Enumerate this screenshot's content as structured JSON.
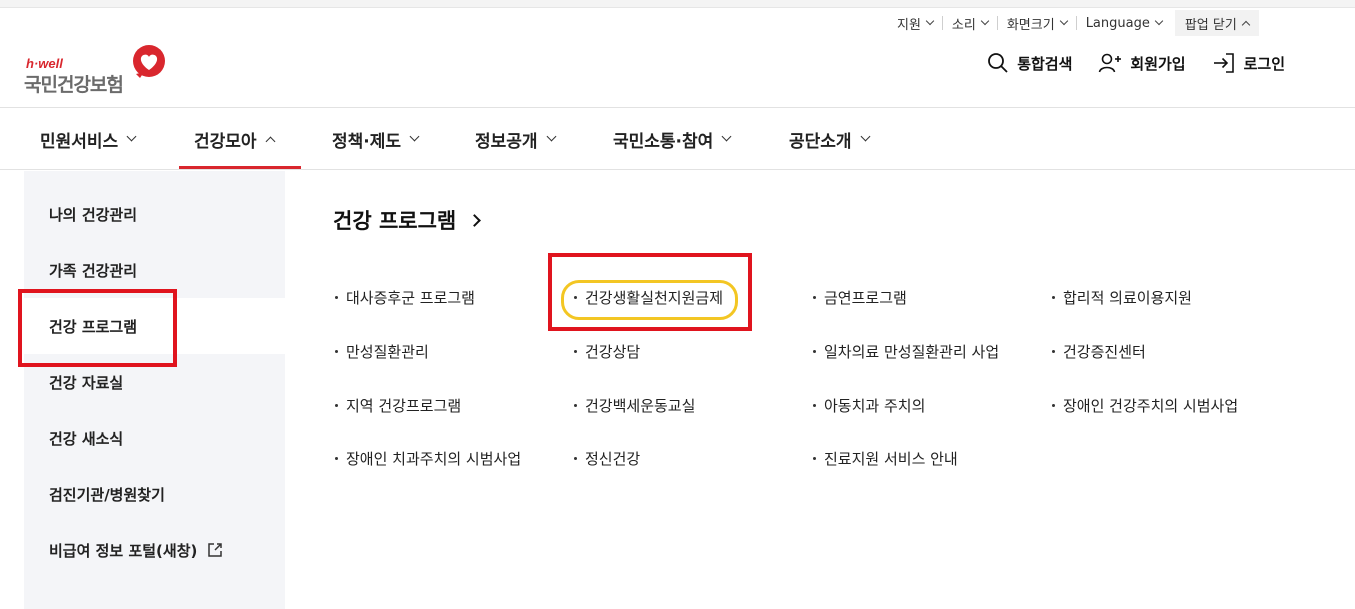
{
  "utility": {
    "support": "지원",
    "sound": "소리",
    "screen_size": "화면크기",
    "language": "Language",
    "close_popup": "팝업 닫기"
  },
  "logo": {
    "brand": "h·well",
    "org_name": "국민건강보험"
  },
  "header_actions": {
    "search": "통합검색",
    "signup": "회원가입",
    "login": "로그인"
  },
  "gnb": [
    {
      "label": "민원서비스"
    },
    {
      "label": "건강모아",
      "active": true
    },
    {
      "label": "정책·제도"
    },
    {
      "label": "정보공개"
    },
    {
      "label": "국민소통·참여"
    },
    {
      "label": "공단소개"
    }
  ],
  "lnb": [
    {
      "label": "나의 건강관리"
    },
    {
      "label": "가족 건강관리"
    },
    {
      "label": "건강 프로그램",
      "active": true
    },
    {
      "label": "건강 자료실"
    },
    {
      "label": "건강 새소식"
    },
    {
      "label": "검진기관/병원찾기"
    },
    {
      "label": "비급여 정보 포털(새창)"
    }
  ],
  "content": {
    "title": "건강 프로그램",
    "links": [
      [
        "대사증후군 프로그램",
        "건강생활실천지원금제",
        "금연프로그램",
        "합리적 의료이용지원"
      ],
      [
        "만성질환관리",
        "건강상담",
        "일차의료 만성질환관리 사업",
        "건강증진센터"
      ],
      [
        "지역 건강프로그램",
        "건강백세운동교실",
        "아동치과 주치의",
        "장애인 건강주치의 시범사업"
      ],
      [
        "장애인 치과주치의 시범사업",
        "정신건강",
        "진료지원 서비스 안내"
      ]
    ]
  },
  "colors": {
    "accent_red": "#d9272e",
    "annotation_red": "#e0141e",
    "annotation_yellow": "#f3c623",
    "sidebar_bg": "#f4f5f8"
  }
}
